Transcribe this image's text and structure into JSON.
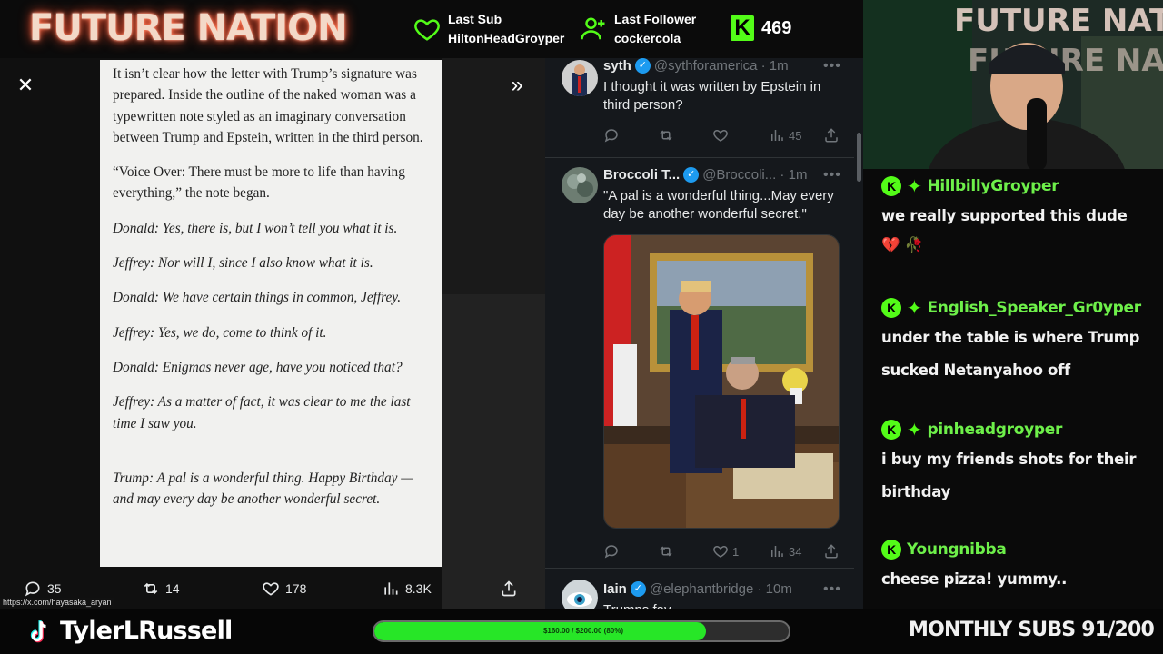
{
  "brand": "FUTURE NATION",
  "stats": {
    "last_sub_label": "Last Sub",
    "last_sub_name": "HiltonHeadGroyper",
    "last_follower_label": "Last Follower",
    "last_follower_name": "cockercola",
    "kick_count": "469"
  },
  "viewer": {
    "article": [
      {
        "text": "It isn’t clear how the letter with Trump’s signature was prepared. Inside the outline of the naked woman was a typewritten note styled as an imaginary conversation between Trump and Epstein, written in the third person.",
        "italic": false
      },
      {
        "text": "“Voice Over: There must be more to life than having everything,” the note began.",
        "italic": false
      },
      {
        "text": "Donald: Yes, there is, but I won’t tell you what it is.",
        "italic": true
      },
      {
        "text": "Jeffrey: Nor will I, since I also know what it is.",
        "italic": true
      },
      {
        "text": "Donald: We have certain things in common, Jeffrey.",
        "italic": true
      },
      {
        "text": "Jeffrey: Yes, we do, come to think of it.",
        "italic": true
      },
      {
        "text": "Donald: Enigmas never age, have you noticed that?",
        "italic": true
      },
      {
        "text": "Jeffrey: As a matter of fact, it was clear to me the last time I saw you.",
        "italic": true
      },
      {
        "text": "Trump: A pal is a wonderful thing. Happy Birthday — and may every day be another wonderful secret.",
        "italic": true
      }
    ],
    "replies": "35",
    "reposts": "14",
    "likes": "178",
    "views": "8.3K",
    "url_tooltip": "https://x.com/hayasaka_aryan"
  },
  "feed": {
    "tweets": [
      {
        "name": "syth",
        "handle": "@sythforamerica · 1m",
        "text": "I thought it was written by Epstein in third person?",
        "replies": "",
        "reposts": "",
        "likes": "",
        "views": "45"
      },
      {
        "name": "Broccoli T...",
        "handle": "@Broccoli... · 1m",
        "text": "\"A pal is a wonderful thing...May every day be another wonderful secret.\"",
        "replies": "",
        "reposts": "",
        "likes": "1",
        "views": "34"
      },
      {
        "name": "Iain",
        "handle": "@elephantbridge · 10m",
        "text": "Trumps fav..."
      }
    ]
  },
  "chat": {
    "messages": [
      {
        "user": "HillbillyGroyper",
        "text": "we really supported this dude",
        "emoji": "💔 🥀"
      },
      {
        "user": "English_Speaker_Gr0yper",
        "text": "under the table is where Trump sucked Netanyahoo off"
      },
      {
        "user": "pinheadgroyper",
        "text": "i buy my friends shots for their birthday"
      },
      {
        "user": "Youngnibba",
        "text": "cheese pizza! yummy.."
      }
    ]
  },
  "bottom": {
    "streamer": "TylerLRussell",
    "goal_text": "$160.00 / $200.00 (80%)",
    "goal_fraction": 0.8,
    "subs_text": "MONTHLY SUBS 91/200"
  },
  "colors": {
    "kick_green": "#53fc18",
    "progress_green": "#27e627",
    "x_blue": "#1d9bf0",
    "chat_user_green": "#6ef04a"
  }
}
